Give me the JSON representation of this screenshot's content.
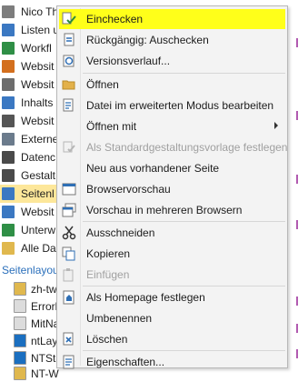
{
  "nav": {
    "items": [
      {
        "label": "Nico Th",
        "color": "#7d7d7d"
      },
      {
        "label": "Listen u",
        "color": "#3b78c2"
      },
      {
        "label": "Workfl",
        "color": "#2f8f46"
      },
      {
        "label": "Websit",
        "color": "#d36f1e"
      },
      {
        "label": "Websit",
        "color": "#6d6d6d"
      },
      {
        "label": "Inhalts",
        "color": "#3b78c2"
      },
      {
        "label": "Websit",
        "color": "#555555"
      },
      {
        "label": "Externe",
        "color": "#6b7b8c"
      },
      {
        "label": "Datenc",
        "color": "#4a4a4a"
      },
      {
        "label": "Gestalt",
        "color": "#4a4a4a"
      },
      {
        "label": "Seitenl",
        "color": "#3b78c2",
        "selected": true
      },
      {
        "label": "Websit",
        "color": "#3b78c2"
      },
      {
        "label": "Unterw",
        "color": "#2f8f46"
      },
      {
        "label": "Alle Da",
        "color": "#e0b84e"
      }
    ],
    "group_header": "Seitenlayou",
    "sub_items": [
      {
        "label": "zh-tw",
        "color": "#e0b84e"
      },
      {
        "label": "Errorl",
        "color": "#dcdcdc"
      },
      {
        "label": "MitNa",
        "color": "#dcdcdc"
      },
      {
        "label": "ntLay",
        "color": "#1b6fc0"
      },
      {
        "label": "NTSta",
        "color": "#1b6fc0"
      },
      {
        "label": "NT-W",
        "color": "#e0b84e"
      }
    ]
  },
  "menu": {
    "items": [
      {
        "label": "Einchecken",
        "icon": "check-in-icon",
        "color": "#2b8a3e",
        "highlighted": true
      },
      {
        "label": "Rückgängig: Auschecken",
        "icon": "undo-checkout-icon",
        "color": "#2f6fb5"
      },
      {
        "label": "Versionsverlauf...",
        "icon": "version-history-icon",
        "color": "#2f6fb5"
      },
      {
        "label": "Öffnen",
        "icon": "folder-open-icon",
        "color": "#e3b14a"
      },
      {
        "label": "Datei im erweiterten Modus bearbeiten",
        "icon": "edit-advanced-icon",
        "color": "#2f6fb5"
      },
      {
        "label": "Öffnen mit",
        "icon": "none",
        "submenu": true
      },
      {
        "label": "Als Standardgestaltungsvorlage festlegen",
        "icon": "default-template-icon",
        "color": "#b7b7b7",
        "disabled": true
      },
      {
        "label": "Neu aus vorhandener Seite",
        "icon": "none"
      },
      {
        "label": "Browservorschau",
        "icon": "browser-preview-icon",
        "color": "#2f6fb5"
      },
      {
        "label": "Vorschau in mehreren Browsern",
        "icon": "multi-browser-preview-icon",
        "color": "#2f6fb5"
      },
      {
        "label": "Ausschneiden",
        "icon": "scissors-icon",
        "color": "#333333"
      },
      {
        "label": "Kopieren",
        "icon": "copy-icon",
        "color": "#2f6fb5"
      },
      {
        "label": "Einfügen",
        "icon": "paste-icon",
        "color": "#b7b7b7",
        "disabled": true
      },
      {
        "label": "Als Homepage festlegen",
        "icon": "set-homepage-icon",
        "color": "#2f6fb5"
      },
      {
        "label": "Umbenennen",
        "icon": "none"
      },
      {
        "label": "Löschen",
        "icon": "delete-icon",
        "color": "#2f6fb5"
      },
      {
        "label": "Eigenschaften...",
        "icon": "properties-icon",
        "color": "#2f6fb5"
      }
    ]
  }
}
